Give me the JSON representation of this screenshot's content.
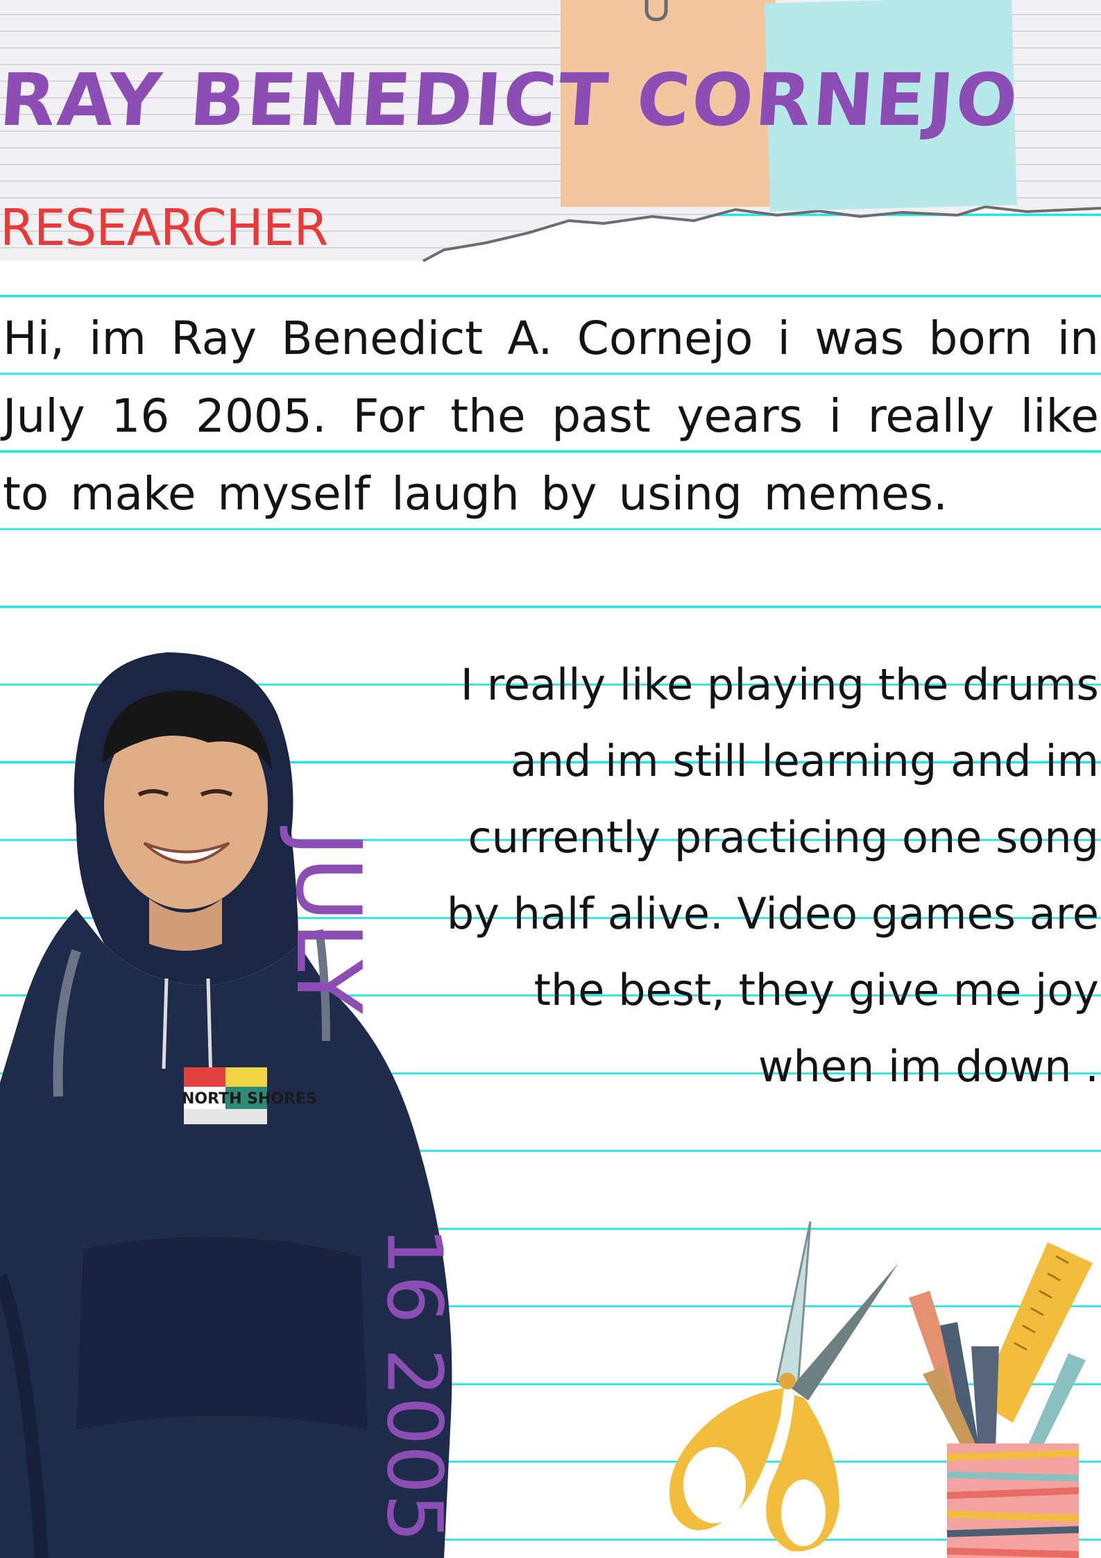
{
  "header": {
    "name": "Ray benedict Cornejo",
    "role": "RESEARCHER"
  },
  "intro": {
    "text": "Hi, im Ray Benedict A. Cornejo i was born in July 16 2005. For the past years i really like to make myself laugh by using memes."
  },
  "hobbies": {
    "text": "I really like playing the drums and im still learning and im currently practicing one song by half alive. Video games are the best, they give me joy when im down ."
  },
  "birthdate": {
    "month": "JULY",
    "day_year": "16 2005"
  },
  "photo": {
    "shirt_print": "NORTH SHORES"
  },
  "colors": {
    "accent_purple": "#8c4db5",
    "role_red": "#e83a3a",
    "rule_cyan": "#27e3e6",
    "tape_peach": "#f3c6a0",
    "tape_blue": "#b8e9ea",
    "hoodie_navy": "#1f2b4a"
  }
}
